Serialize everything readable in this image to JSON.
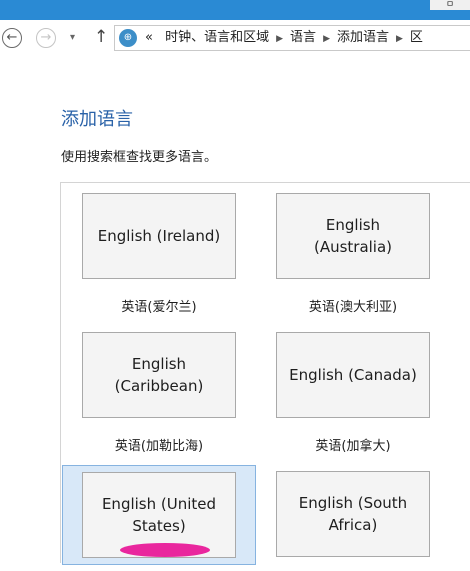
{
  "titlebar": {
    "window_control": "ㅁ"
  },
  "nav": {
    "back_icon": "←",
    "forward_icon": "→",
    "dropdown_icon": "▾",
    "up_icon": "↑",
    "address_icon_glyph": "⊕",
    "overflow": "«",
    "breadcrumbs": [
      "时钟、语言和区域",
      "语言",
      "添加语言",
      "区"
    ]
  },
  "main": {
    "title": "添加语言",
    "description": "使用搜索框查找更多语言。"
  },
  "languages": [
    {
      "tile": "English (Ireland)",
      "caption": "英语(爱尔兰)"
    },
    {
      "tile": "English (Australia)",
      "caption": "英语(澳大利亚)"
    },
    {
      "tile": "English (Caribbean)",
      "caption": "英语(加勒比海)"
    },
    {
      "tile": "English (Canada)",
      "caption": "英语(加拿大)"
    },
    {
      "tile": "English (United States)",
      "caption": ""
    },
    {
      "tile": "English (South Africa)",
      "caption": ""
    }
  ],
  "colors": {
    "title_blue": "#2a62a8",
    "titlebar_blue": "#2a8ad4",
    "selection_bg": "#d8e8f8"
  }
}
